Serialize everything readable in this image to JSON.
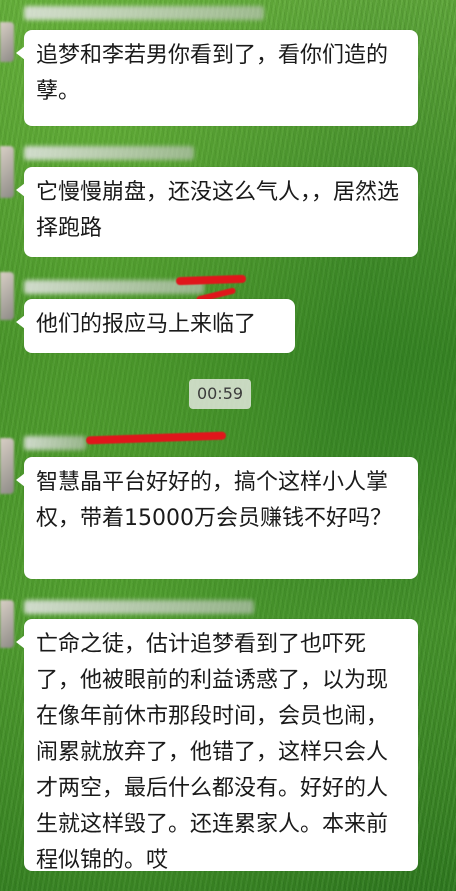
{
  "chat": {
    "messages": [
      {
        "text": "追梦和李若男你看到了，看你们造的孽。"
      },
      {
        "text": "它慢慢崩盘，还没这么气人，，居然选择跑路"
      },
      {
        "text": "他们的报应马上来临了"
      },
      {
        "text": "智慧晶平台好好的，搞个这样小人掌权，带着15000万会员赚钱不好吗？"
      },
      {
        "text": "亡命之徒，估计追梦看到了也吓死了，他被眼前的利益诱惑了，以为现在像年前休市那段时间，会员也闹，闹累就放弃了，他错了，这样只会人才两空，最后什么都没有。好好的人生就这样毁了。还连累家人。本来前程似锦的。哎"
      }
    ],
    "timestamp": "00:59"
  },
  "colors": {
    "bubble": "#ffffff",
    "text": "#1a1a1a",
    "redaction": "#e0161b",
    "background": "#4d9a2e"
  }
}
